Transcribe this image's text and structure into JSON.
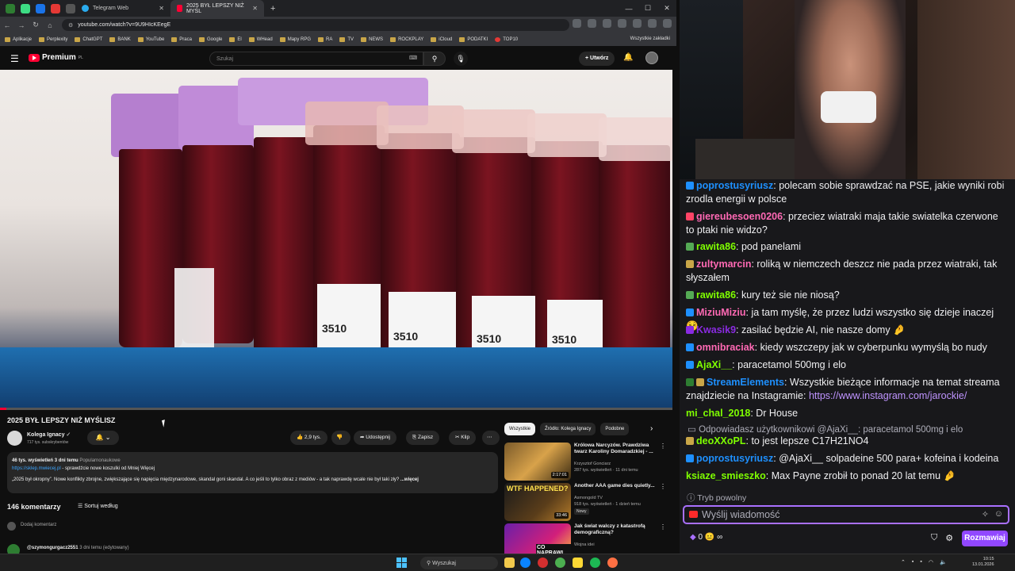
{
  "browser": {
    "tabs": [
      {
        "title": "Telegram Web"
      },
      {
        "title": "2025 BYŁ LEPSZY NIŻ MYŚL"
      }
    ],
    "url": "youtube.com/watch?v=9U9HIcKEegE",
    "bookmarks": [
      "Aplikacje",
      "Perplexity",
      "ChatGPT",
      "BANK",
      "YouTube",
      "Praca",
      "Google",
      "El",
      "WHead",
      "Mapy RPG",
      "RA",
      "TV",
      "NEWS",
      "ROCKPLAY",
      "iCloud",
      "PODATKI",
      "TOP10"
    ],
    "bookmarks_right": "Wszystkie zakładki"
  },
  "youtube": {
    "logo_text": "Premium",
    "logo_sup": "PL",
    "search_placeholder": "Szukaj",
    "create_label": "+ Utwórz",
    "video": {
      "title": "2025 BYŁ LEPSZY NIŻ MYŚLISZ",
      "channel": "Kolega Ignacy",
      "subscribers": "717 tys. subskrybentów",
      "likes": "2,9 tys.",
      "share": "Udostępnij",
      "save": "Zapisz",
      "clip": "Klip",
      "views_line": "46 tys. wyświetleń  3 dni temu",
      "category": "Popularnonaukowe",
      "link": "https://sklep.mwiecej.pl",
      "link_suffix": " - sprawdźcie nowe koszulki od Mniej Więcej",
      "desc": "„2025 był okropny”. Nowe konflikty zbrojne, zwiększające się napięcia międzynarodowe, skandal goni skandal. A co jeśli to tylko obraz z mediów - a tak naprawdę wcale nie był taki zły?",
      "more": "...więcej",
      "tube_labels": [
        "3510",
        "3510",
        "3510",
        "3510"
      ]
    },
    "comments": {
      "count": "146 komentarzy",
      "sort": "Sortuj według",
      "add": "Dodaj komentarz",
      "first_author": "@szymongurgacz2551",
      "first_meta": "3 dni temu (edytowany)"
    },
    "chips": [
      "Wszystkie",
      "Źródło: Kolega Ignacy",
      "Podobne"
    ],
    "related": [
      {
        "title": "Królowa Narcyzów. Prawdziwa twarz Karoliny Domaradzkiej - ...",
        "channel": "Krzysztof Gonciarz",
        "meta": "287 tys. wyświetleń · 11 dni temu",
        "duration": "2:17:01",
        "badge": ""
      },
      {
        "title": "Another AAA game dies quietly...",
        "channel": "Asmongold TV",
        "meta": "918 tys. wyświetleń · 1 dzień temu",
        "duration": "33:46",
        "badge": "Nowy",
        "thumb_text": "WTF HAPPENED?"
      },
      {
        "title": "Jak świat walczy z katastrofą demograficzną?",
        "channel": "Wojna idei",
        "meta": "",
        "duration": "",
        "badge": "",
        "thumb_text": "CO NAPRAWI"
      }
    ]
  },
  "chat": {
    "messages": [
      {
        "user": "poprostusyriusz",
        "color": "#1e90ff",
        "text": ": polecam sobie sprawdzać na PSE, jakie wyniki robi zrodla energii w polsce"
      },
      {
        "user": "giereubesoen0206",
        "color": "#ff69b4",
        "text": ": przeciez wiatraki maja takie swiatelka czerwone to ptaki nie widzo?"
      },
      {
        "user": "rawita86",
        "color": "#7fff00",
        "text": ": pod panelami"
      },
      {
        "user": "zultymarcin",
        "color": "#ff69b4",
        "text": ": roliką w niemczech deszcz nie pada przez wiatraki, tak słyszałem"
      },
      {
        "user": "rawita86",
        "color": "#7fff00",
        "text": ": kury też sie nie niosą?"
      },
      {
        "user": "MiziuMiziu",
        "color": "#ff69b4",
        "text": ": ja tam myślę, że przez ludzi wszystko się dzieje inaczej"
      },
      {
        "user": "Kwasik9",
        "color": "#8a2be2",
        "text": ": zasilać będzie AI, nie nasze domy"
      },
      {
        "user": "omnibraciak",
        "color": "#ff69b4",
        "text": ": kiedy wszczepy jak w cyberpunku wymyślą bo nudy"
      },
      {
        "user": "AjaXi__",
        "color": "#7fff00",
        "text": ": paracetamol 500mg i elo"
      },
      {
        "user": "StreamElements",
        "color": "#1e90ff",
        "text": ": Wszystkie bieżące informacje na temat streama znajdziecie na Instagramie: ",
        "link": "https://www.instagram.com/jarockie/"
      },
      {
        "user": "mi_chal_2018",
        "color": "#7fff00",
        "text": ": Dr House"
      },
      {
        "user": "deoXXoPL",
        "color": "#7fff00",
        "text": ": to jest lepsze C17H21NO4"
      },
      {
        "user": "poprostusyriusz",
        "color": "#1e90ff",
        "text": ": @AjaXi__ solpadeine 500 para+ kofeina i kodeina"
      },
      {
        "user": "ksiaze_smieszko",
        "color": "#7fff00",
        "text": ": Max Payne zrobił to ponad 20 lat temu"
      }
    ],
    "reply_line": "Odpowiadasz użytkownikowi @AjaXi__: paracetamol 500mg i elo",
    "slow_mode": "Tryb powolny",
    "input_placeholder": "Wyślij wiadomość",
    "points": "0",
    "infinity": "∞",
    "send_button": "Rozmawiaj"
  },
  "taskbar": {
    "search": "Wyszukaj",
    "time": "10:15",
    "date": "13.01.2026"
  }
}
